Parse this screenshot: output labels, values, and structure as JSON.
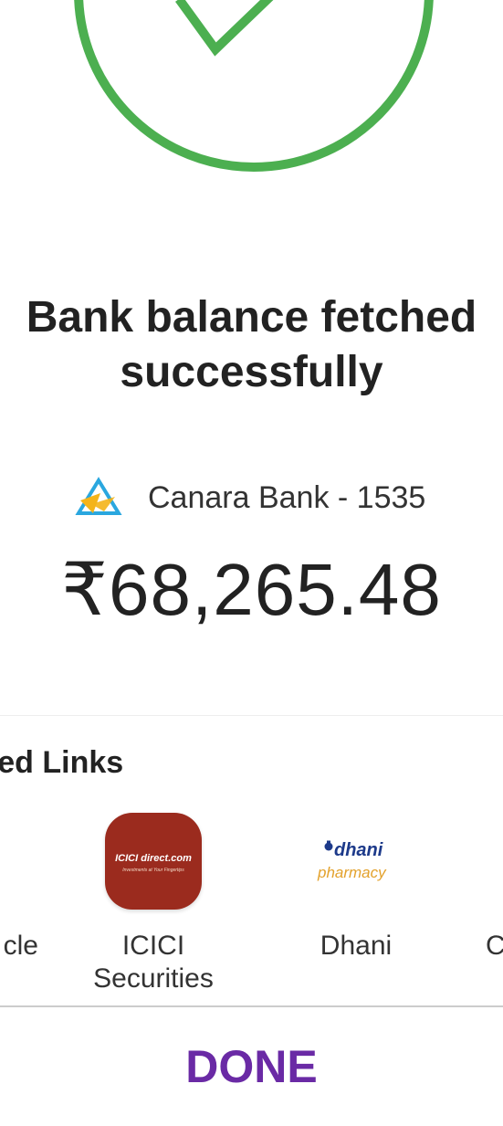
{
  "status": {
    "title_line1": "Bank balance fetched",
    "title_line2": "successfully",
    "success_color": "#4caf50"
  },
  "account": {
    "bank_label": "Canara Bank - 1535",
    "balance": "₹68,265.48"
  },
  "links": {
    "section_title": "red Links",
    "items": [
      {
        "label": "cle"
      },
      {
        "label_line1": "ICICI",
        "label_line2": "Securities",
        "logo_text": "ICICI direct.com",
        "logo_tagline": "Investments at Your Fingertips"
      },
      {
        "label": "Dhani",
        "logo_text": "dhani",
        "logo_subtext": "pharmacy"
      },
      {
        "label": "C"
      }
    ]
  },
  "actions": {
    "done_label": "DONE",
    "done_color": "#6a2aa5"
  }
}
